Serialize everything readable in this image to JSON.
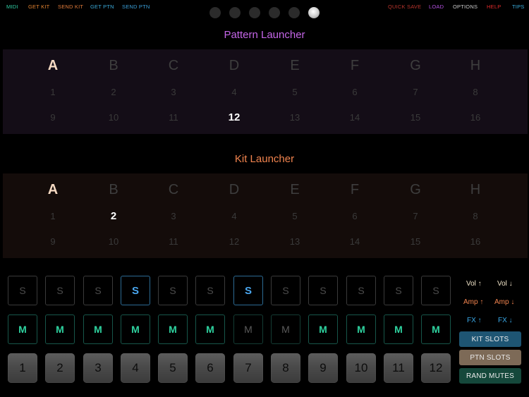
{
  "nav": {
    "midi": "MIDI",
    "get_kit": "GET KIT",
    "send_kit": "SEND KIT",
    "get_ptn": "GET PTN",
    "send_ptn": "SEND PTN",
    "quick_save": "QUICK SAVE",
    "load": "LOAD",
    "options": "OPTIONS",
    "help": "HELP",
    "tips": "TIPS"
  },
  "colors": {
    "midi": "#2fcfa5",
    "get_kit": "#e0812f",
    "send_kit": "#e07a3a",
    "get_ptn": "#3aa9d8",
    "send_ptn": "#3a9fd8",
    "quick_save": "#b8342c",
    "load": "#b450e0",
    "options": "#c8c8c8",
    "help": "#e02a2a",
    "tips": "#3ab0e0",
    "pattern_title": "#c566e8",
    "kit_title": "#f0834e",
    "solo_active": "#4aa7f0",
    "mute_active": "#2fd3a0"
  },
  "page_indicator": {
    "count": 6,
    "active_index": 5
  },
  "pattern_launcher": {
    "title": "Pattern Launcher",
    "banks": [
      "A",
      "B",
      "C",
      "D",
      "E",
      "F",
      "G",
      "H"
    ],
    "selected_bank": "A",
    "row1": [
      "1",
      "2",
      "3",
      "4",
      "5",
      "6",
      "7",
      "8"
    ],
    "row2": [
      "9",
      "10",
      "11",
      "12",
      "13",
      "14",
      "15",
      "16"
    ],
    "selected_number": "12"
  },
  "kit_launcher": {
    "title": "Kit Launcher",
    "banks": [
      "A",
      "B",
      "C",
      "D",
      "E",
      "F",
      "G",
      "H"
    ],
    "selected_bank": "A",
    "row1": [
      "1",
      "2",
      "3",
      "4",
      "5",
      "6",
      "7",
      "8"
    ],
    "row2": [
      "9",
      "10",
      "11",
      "12",
      "13",
      "14",
      "15",
      "16"
    ],
    "selected_number": "2"
  },
  "solo": {
    "label": "S",
    "states": [
      false,
      false,
      false,
      true,
      false,
      false,
      true,
      false,
      false,
      false,
      false,
      false
    ]
  },
  "mute": {
    "label": "M",
    "states": [
      true,
      true,
      true,
      true,
      true,
      true,
      false,
      false,
      true,
      true,
      true,
      true
    ]
  },
  "tracks": [
    "1",
    "2",
    "3",
    "4",
    "5",
    "6",
    "7",
    "8",
    "9",
    "10",
    "11",
    "12"
  ],
  "controls": {
    "vol_up": "Vol ↑",
    "vol_down": "Vol ↓",
    "amp_up": "Amp ↑",
    "amp_down": "Amp ↓",
    "fx_up": "FX ↑",
    "fx_down": "FX ↓",
    "vol_color": "#f0e3c8",
    "amp_color": "#f0834e",
    "fx_color": "#3aa9e8"
  },
  "slots": {
    "kit_slots": "KIT SLOTS",
    "ptn_slots": "PTN SLOTS",
    "rand_mutes": "RAND MUTES",
    "kit_color": "#1e5573",
    "ptn_color": "#7d6a57",
    "rand_color": "#15483b"
  }
}
